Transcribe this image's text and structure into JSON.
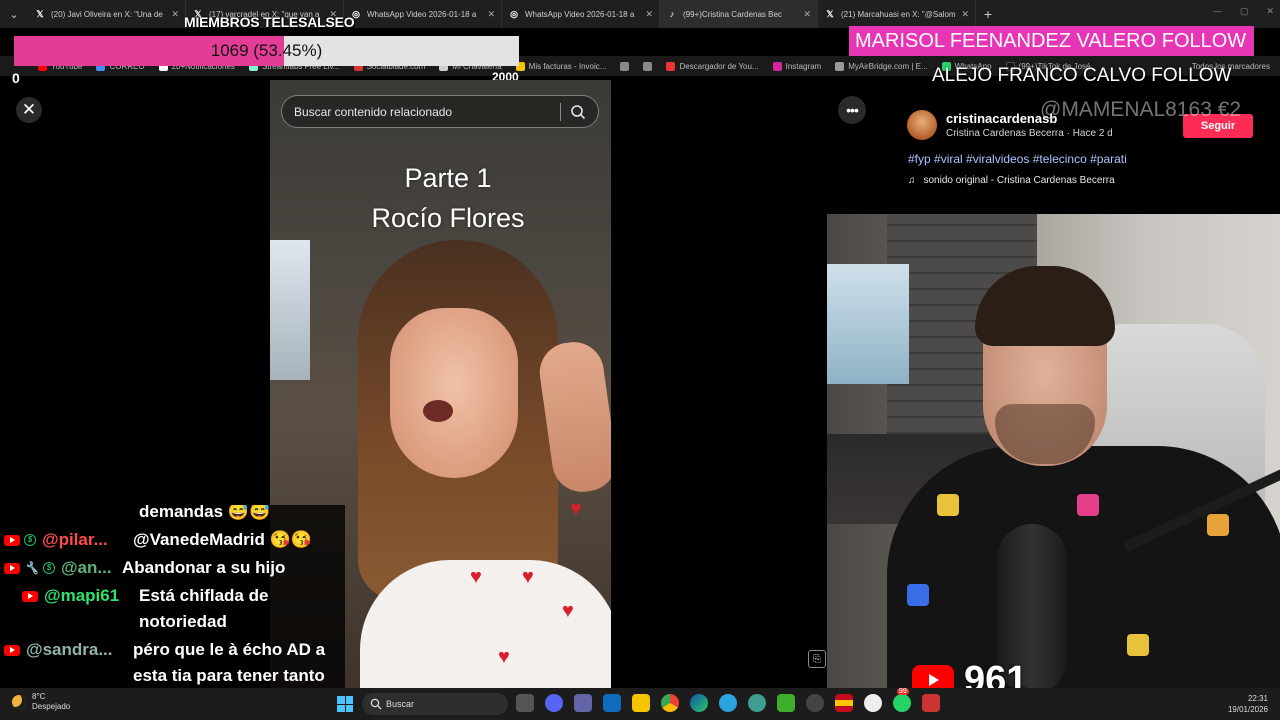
{
  "browser": {
    "tabs": [
      {
        "icon": "x-icon",
        "title": "(20) Javi Oliveira en X: \"Una de"
      },
      {
        "icon": "x-icon",
        "title": "(17) varcradel en X: \"que van a"
      },
      {
        "icon": "globe-icon",
        "title": "WhatsApp Video 2026-01-18 a"
      },
      {
        "icon": "globe-icon",
        "title": "WhatsApp Video 2026-01-18 a"
      },
      {
        "icon": "tiktok-icon",
        "title": "(99+)Cristina Cardenas Bec"
      },
      {
        "icon": "x-icon",
        "title": "(21) Marcahuasi en X: \"@Salom"
      }
    ],
    "bookmarks": [
      {
        "label": "YouTube",
        "color": "#ff0000"
      },
      {
        "label": "CORREO",
        "color": "#4a8cff"
      },
      {
        "label": "20+Notificaciones",
        "color": "#ffffff"
      },
      {
        "label": "Streamlabs Free Liv...",
        "color": "#80f5d2"
      },
      {
        "label": "Socialblade.com",
        "color": "#d33"
      },
      {
        "label": "Mi Chavalería",
        "color": "#ccc"
      },
      {
        "label": "Mis facturas - Invoic...",
        "color": "#f5c400"
      },
      {
        "label": "",
        "color": "#888"
      },
      {
        "label": "",
        "color": "#888"
      },
      {
        "label": "Descargador de You...",
        "color": "#e33"
      },
      {
        "label": "Instagram",
        "color": "#d6249f"
      },
      {
        "label": "MyAirBridge.com | E...",
        "color": "#999"
      },
      {
        "label": "WhatsApp",
        "color": "#25d366"
      },
      {
        "label": "(99+)TikTok de José",
        "color": "#111"
      }
    ],
    "all_bookmarks": "Todos los marcadores"
  },
  "goal": {
    "title": "MIEMBROS TELESALSEO",
    "text": "1069 (53.45%)",
    "progress_percent": 53.45,
    "min": "0",
    "max": "2000",
    "fill_color": "#e23c96"
  },
  "tiktok": {
    "search_placeholder": "Buscar contenido relacionado",
    "caption_line1": "Parte 1",
    "caption_line2": "Rocío Flores",
    "author_handle": "cristinacardenasb",
    "author_meta": "Cristina Cardenas Becerra · Hace 2 d",
    "follow_label": "Seguir",
    "hashtags": "#fyp #viral #viralvideos #telecinco #parati",
    "sound": "sonido original - Cristina Cardenas Becerra",
    "accent_color": "#fe2c55"
  },
  "alerts": {
    "follower_1": "MARISOL FEENANDEZ VALERO  FOLLOW",
    "follower_2": "ALEJO FRANCO CALVO  FOLLOW",
    "donation": "@MAMENAL8163  €2"
  },
  "stream": {
    "youtube_viewers": "961"
  },
  "chat": {
    "partial_top": "demandas 😅😅",
    "messages": [
      {
        "user": "@pilar...",
        "user_color": "#ff4b4b",
        "badges": [
          "youtube",
          "dollar"
        ],
        "text": "@VanedeMadrid 😘😘"
      },
      {
        "user": "@an...",
        "user_color": "#5db37a",
        "badges": [
          "youtube",
          "wrench",
          "dollar"
        ],
        "text": "Abandonar a su hijo"
      },
      {
        "user": "@mapi61",
        "user_color": "#2ee06c",
        "badges": [
          "youtube"
        ],
        "text": "Está chiflada de notoriedad"
      },
      {
        "user": "@sandra...",
        "user_color": "#8fb3a8",
        "badges": [
          "youtube"
        ],
        "text": "péro que le à écho AD a esta tia para tener tanto odio?"
      }
    ]
  },
  "taskbar": {
    "weather_temp": "8°C",
    "weather_desc": "Despejado",
    "search_label": "Buscar",
    "time": "22:31",
    "date": "19/01/2026",
    "whatsapp_badge": "99"
  }
}
